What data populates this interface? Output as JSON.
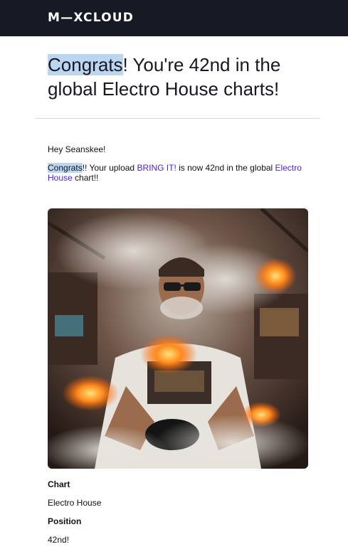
{
  "header": {
    "logo_text": "M—XCLOUD",
    "background": "#171a24"
  },
  "headline": {
    "highlight": "Congrats",
    "rest": "! You're 42nd in the global Electro House charts!"
  },
  "message": {
    "greeting": "Hey Seanskee!",
    "congrats": "Congrats",
    "after_congrats": "!! Your upload ",
    "upload_link": "BRING IT!",
    "middle": " is now 42nd in the global ",
    "chart_link": "Electro House",
    "end": " chart!!"
  },
  "details": {
    "chart_label": "Chart",
    "chart_value": "Electro House",
    "position_label": "Position",
    "position_value": "42nd!"
  },
  "colors": {
    "link": "#4b1fd6",
    "highlight": "#bcd6f2"
  }
}
